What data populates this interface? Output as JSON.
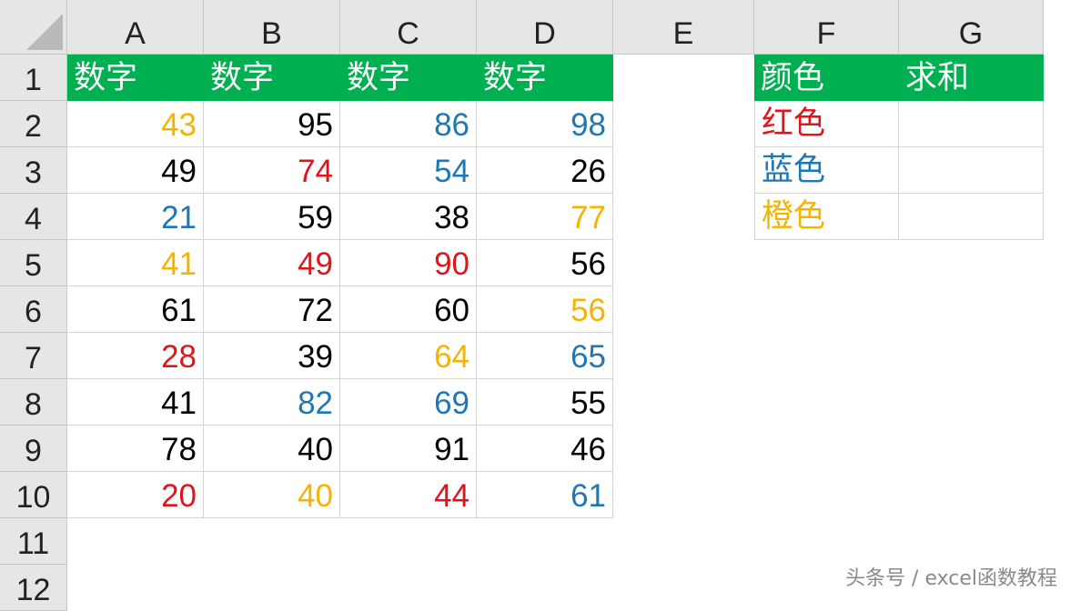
{
  "colors": {
    "header_bg": "#00b050",
    "header_text": "#ffffff",
    "yellow": "#f4b400",
    "black": "#000000",
    "blue": "#1f77b4",
    "red": "#e0151b"
  },
  "sheet": {
    "columns": [
      "A",
      "B",
      "C",
      "D",
      "E",
      "F",
      "G"
    ],
    "rows": [
      "1",
      "2",
      "3",
      "4",
      "5",
      "6",
      "7",
      "8",
      "9",
      "10",
      "11",
      "12"
    ],
    "data_header": [
      "数字",
      "数字",
      "数字",
      "数字"
    ],
    "data_rows": [
      [
        {
          "v": "43",
          "c": "yellow"
        },
        {
          "v": "95",
          "c": "black"
        },
        {
          "v": "86",
          "c": "blue"
        },
        {
          "v": "98",
          "c": "blue"
        }
      ],
      [
        {
          "v": "49",
          "c": "black"
        },
        {
          "v": "74",
          "c": "red"
        },
        {
          "v": "54",
          "c": "blue"
        },
        {
          "v": "26",
          "c": "black"
        }
      ],
      [
        {
          "v": "21",
          "c": "blue"
        },
        {
          "v": "59",
          "c": "black"
        },
        {
          "v": "38",
          "c": "black"
        },
        {
          "v": "77",
          "c": "yellow"
        }
      ],
      [
        {
          "v": "41",
          "c": "yellow"
        },
        {
          "v": "49",
          "c": "red"
        },
        {
          "v": "90",
          "c": "red"
        },
        {
          "v": "56",
          "c": "black"
        }
      ],
      [
        {
          "v": "61",
          "c": "black"
        },
        {
          "v": "72",
          "c": "black"
        },
        {
          "v": "60",
          "c": "black"
        },
        {
          "v": "56",
          "c": "yellow"
        }
      ],
      [
        {
          "v": "28",
          "c": "red"
        },
        {
          "v": "39",
          "c": "black"
        },
        {
          "v": "64",
          "c": "yellow"
        },
        {
          "v": "65",
          "c": "blue"
        }
      ],
      [
        {
          "v": "41",
          "c": "black"
        },
        {
          "v": "82",
          "c": "blue"
        },
        {
          "v": "69",
          "c": "blue"
        },
        {
          "v": "55",
          "c": "black"
        }
      ],
      [
        {
          "v": "78",
          "c": "black"
        },
        {
          "v": "40",
          "c": "black"
        },
        {
          "v": "91",
          "c": "black"
        },
        {
          "v": "46",
          "c": "black"
        }
      ],
      [
        {
          "v": "20",
          "c": "red"
        },
        {
          "v": "40",
          "c": "yellow"
        },
        {
          "v": "44",
          "c": "red"
        },
        {
          "v": "61",
          "c": "blue"
        }
      ]
    ],
    "summary_header": [
      "颜色",
      "求和"
    ],
    "summary_rows": [
      {
        "color_name": "红色",
        "c": "red",
        "sum": ""
      },
      {
        "color_name": "蓝色",
        "c": "blue",
        "sum": ""
      },
      {
        "color_name": "橙色",
        "c": "yellow",
        "sum": ""
      }
    ]
  },
  "watermark": "头条号 / excel函数教程"
}
